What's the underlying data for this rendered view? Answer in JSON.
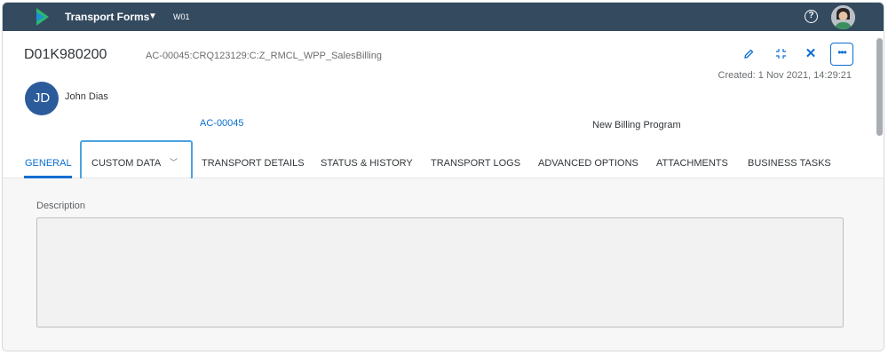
{
  "shell": {
    "app_title": "Transport Forms",
    "system_id": "W01",
    "help_label": "?",
    "colors": {
      "bar": "#344a5f"
    }
  },
  "header": {
    "object_id": "D01K980200",
    "object_path": "AC-00045:CRQ123129:C:Z_RMCL_WPP_SalesBilling",
    "created": "Created: 1 Nov 2021, 14:29:21",
    "user_initials": "JD",
    "user_name": "John Dias",
    "link": "AC-00045",
    "program": "New Billing Program",
    "actions": {
      "edit_icon": "pencil-icon",
      "exit_fullscreen_icon": "exit-fullscreen-icon",
      "close_icon": "close-icon",
      "more_icon": "more-icon"
    }
  },
  "tabs": [
    {
      "label": "GENERAL",
      "active": true
    },
    {
      "label": "CUSTOM DATA",
      "active": false
    },
    {
      "label": "TRANSPORT DETAILS",
      "active": false
    },
    {
      "label": "STATUS & HISTORY",
      "active": false
    },
    {
      "label": "TRANSPORT LOGS",
      "active": false
    },
    {
      "label": "ADVANCED OPTIONS",
      "active": false
    },
    {
      "label": "ATTACHMENTS",
      "active": false
    },
    {
      "label": "BUSINESS TASKS",
      "active": false
    }
  ],
  "content": {
    "description_label": "Description",
    "description_value": ""
  },
  "accent_color": "#0a6ed1"
}
